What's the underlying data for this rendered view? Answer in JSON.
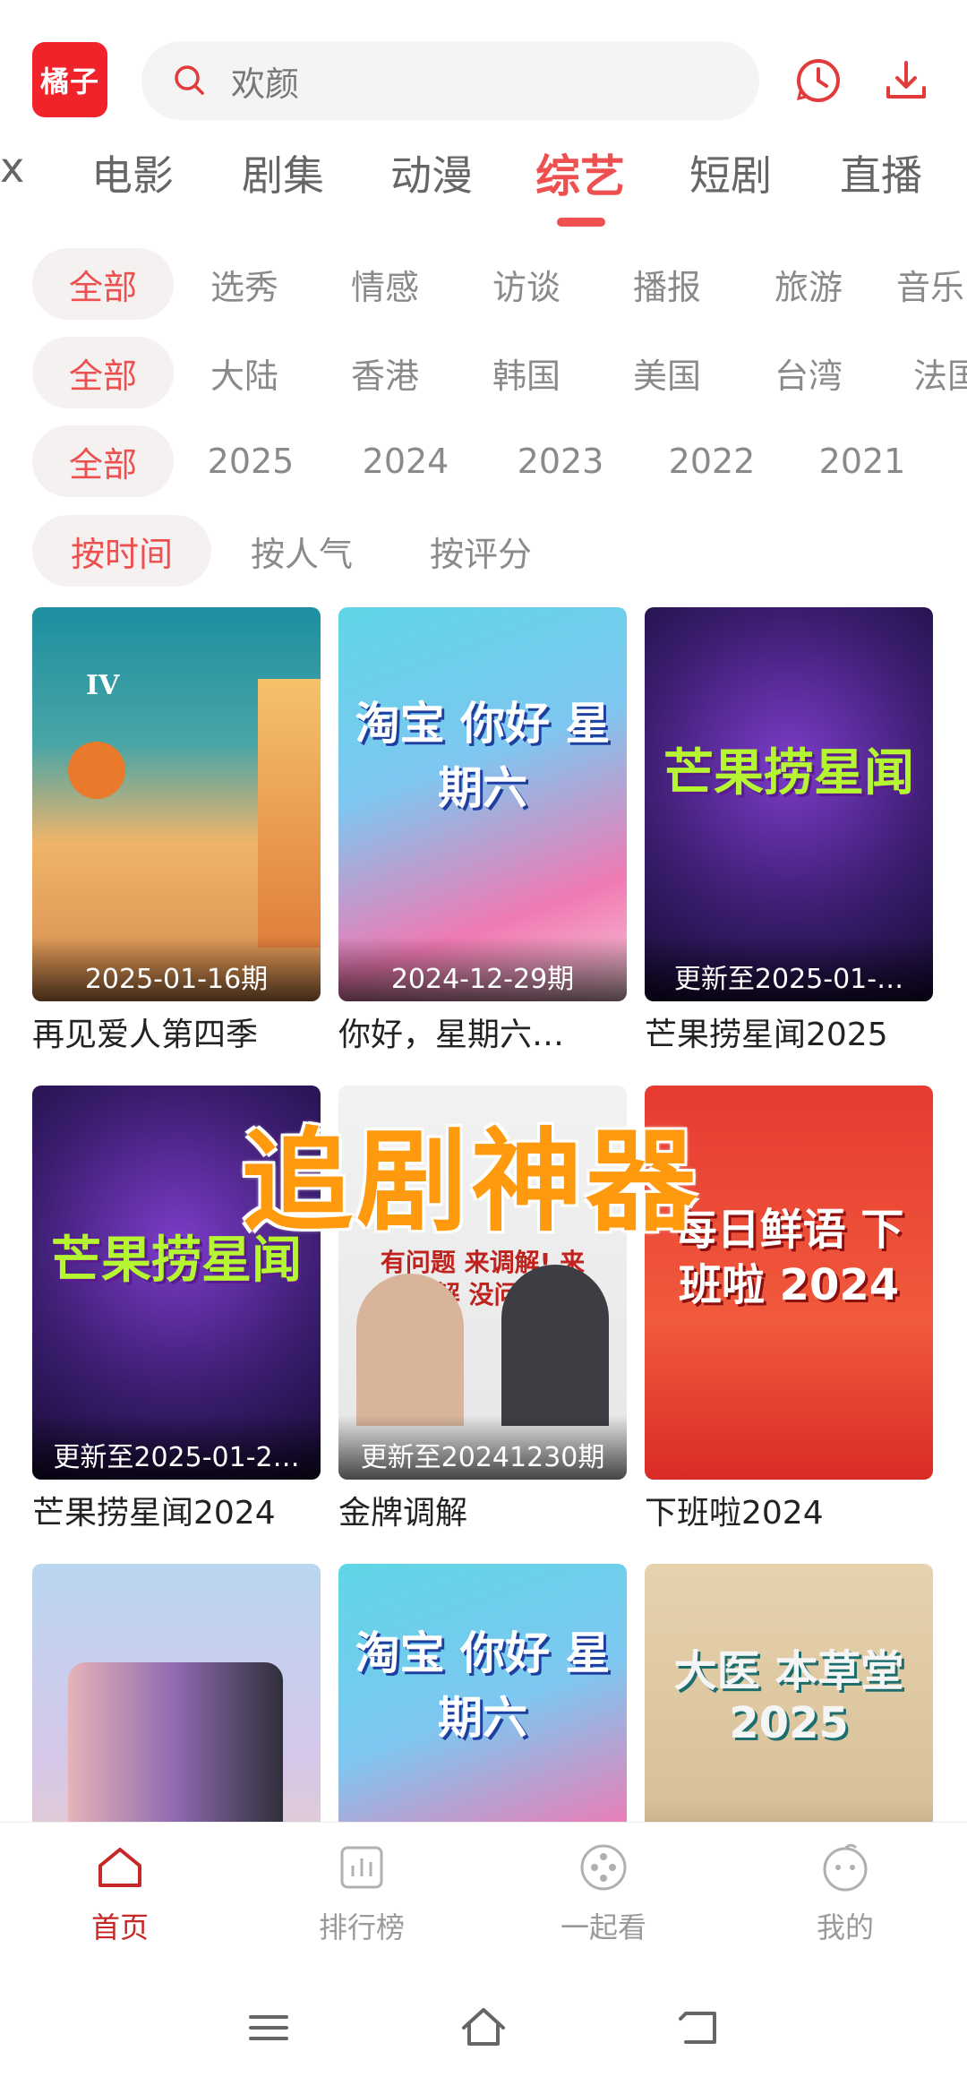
{
  "header": {
    "logo_text": "橘子",
    "search_placeholder": "欢颜"
  },
  "categories": {
    "items": [
      "x",
      "电影",
      "剧集",
      "动漫",
      "综艺",
      "短剧",
      "直播"
    ],
    "active_index": 4
  },
  "filters": {
    "type": [
      "全部",
      "选秀",
      "情感",
      "访谈",
      "播报",
      "旅游",
      "音乐"
    ],
    "region": [
      "全部",
      "大陆",
      "香港",
      "韩国",
      "美国",
      "台湾",
      "法国"
    ],
    "year": [
      "全部",
      "2025",
      "2024",
      "2023",
      "2022",
      "2021"
    ],
    "sort": [
      "按时间",
      "按人气",
      "按评分"
    ]
  },
  "grid": [
    {
      "badge": "2025-01-16期",
      "title": "再见爱人第四季",
      "art": "IV"
    },
    {
      "badge": "2024-12-29期",
      "title": "你好，星期六…",
      "art": "淘宝 你好 星期六"
    },
    {
      "badge": "更新至2025-01-…",
      "title": "芒果捞星闻2025",
      "art": "芒果捞星闻"
    },
    {
      "badge": "更新至2025-01-2…",
      "title": "芒果捞星闻2024",
      "art": "芒果捞星闻"
    },
    {
      "badge": "更新至20241230期",
      "title": "金牌调解",
      "art": "有问题 来调解! 来调解 没问题!"
    },
    {
      "badge": "",
      "title": "下班啦2024",
      "art": "每日鲜语 下班啦 2024"
    },
    {
      "badge": "",
      "title": "",
      "art": ""
    },
    {
      "badge": "",
      "title": "",
      "art": "淘宝 你好 星期六"
    },
    {
      "badge": "",
      "title": "",
      "art": "大医 本草堂 2025"
    }
  ],
  "overlay_text": "追剧神器",
  "bottom_nav": [
    {
      "label": "首页",
      "icon": "home-icon",
      "active": true
    },
    {
      "label": "排行榜",
      "icon": "chart-icon",
      "active": false
    },
    {
      "label": "一起看",
      "icon": "film-reel-icon",
      "active": false
    },
    {
      "label": "我的",
      "icon": "profile-face-icon",
      "active": false
    }
  ],
  "colors": {
    "accent": "#ee4f4f",
    "logo_bg": "#f0232b",
    "overlay": "#ff9a0f"
  }
}
